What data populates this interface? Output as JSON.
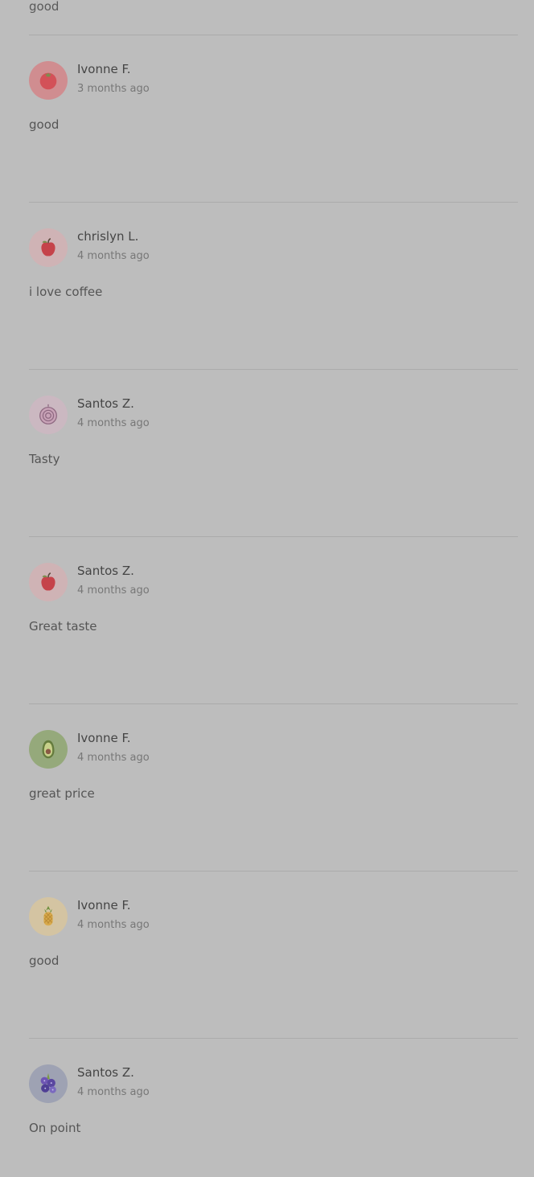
{
  "top_partial_review": {
    "comment": "good"
  },
  "reviews": [
    {
      "name": "Ivonne F.",
      "time": "3 months ago",
      "comment": "good",
      "avatar": {
        "icon": "tomato-icon",
        "background": "#d08d90"
      }
    },
    {
      "name": "chrislyn L.",
      "time": "4 months ago",
      "comment": "i love coffee",
      "avatar": {
        "icon": "apple-icon",
        "background": "#cfb3b5"
      }
    },
    {
      "name": "Santos Z.",
      "time": "4 months ago",
      "comment": "Tasty",
      "avatar": {
        "icon": "onion-icon",
        "background": "#cbb8c1"
      }
    },
    {
      "name": "Santos Z.",
      "time": "4 months ago",
      "comment": "Great taste",
      "avatar": {
        "icon": "apple-icon",
        "background": "#cfb3b5"
      }
    },
    {
      "name": "Ivonne F.",
      "time": "4 months ago",
      "comment": "great price",
      "avatar": {
        "icon": "avocado-icon",
        "background": "#95a97b"
      }
    },
    {
      "name": "Ivonne F.",
      "time": "4 months ago",
      "comment": "good",
      "avatar": {
        "icon": "pineapple-icon",
        "background": "#d4c4a2"
      }
    },
    {
      "name": "Santos Z.",
      "time": "4 months ago",
      "comment": "On point",
      "avatar": {
        "icon": "blueberry-icon",
        "background": "#9ea2b3"
      }
    }
  ]
}
